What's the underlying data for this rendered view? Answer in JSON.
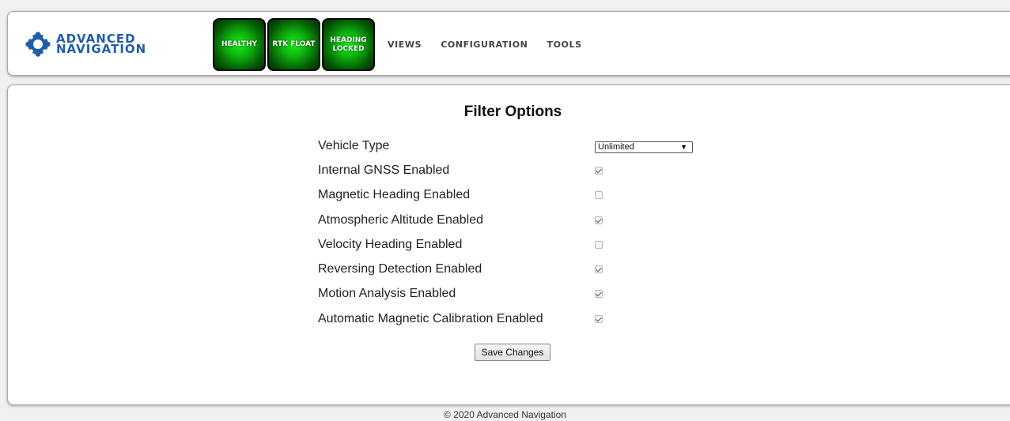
{
  "brand": {
    "line1": "ADVANCED",
    "line2": "NAVIGATION",
    "icon": "advanced-navigation-logo",
    "color": "#1f5fa8"
  },
  "status": [
    {
      "lines": [
        "HEALTHY"
      ]
    },
    {
      "lines": [
        "RTK FLOAT"
      ]
    },
    {
      "lines": [
        "HEADING",
        "LOCKED"
      ]
    }
  ],
  "status_color": "#0eb10e",
  "nav": [
    "VIEWS",
    "CONFIGURATION",
    "TOOLS"
  ],
  "panel": {
    "title": "Filter Options",
    "vehicle_type": {
      "label": "Vehicle Type",
      "value": "Unlimited"
    },
    "options": [
      {
        "label": "Internal GNSS Enabled",
        "checked": true
      },
      {
        "label": "Magnetic Heading Enabled",
        "checked": false
      },
      {
        "label": "Atmospheric Altitude Enabled",
        "checked": true
      },
      {
        "label": "Velocity Heading Enabled",
        "checked": false
      },
      {
        "label": "Reversing Detection Enabled",
        "checked": true
      },
      {
        "label": "Motion Analysis Enabled",
        "checked": true
      },
      {
        "label": "Automatic Magnetic Calibration Enabled",
        "checked": true
      }
    ],
    "save_label": "Save Changes"
  },
  "footer": "© 2020 Advanced Navigation"
}
